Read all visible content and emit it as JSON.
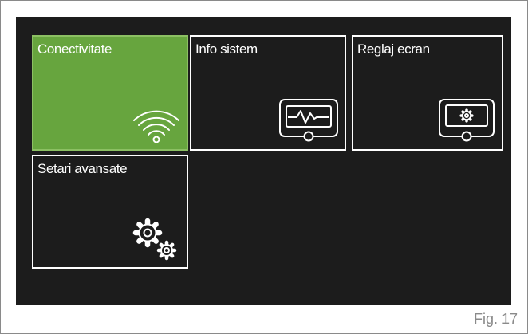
{
  "tiles": [
    {
      "id": "conectivitate",
      "label": "Conectivitate",
      "icon": "wifi-icon",
      "selected": true
    },
    {
      "id": "info-sistem",
      "label": "Info sistem",
      "icon": "monitor-waveform-icon",
      "selected": false
    },
    {
      "id": "reglaj-ecran",
      "label": "Reglaj ecran",
      "icon": "display-settings-icon",
      "selected": false
    },
    {
      "id": "setari-avansate",
      "label": "Setari avansate",
      "icon": "gears-icon",
      "selected": false
    }
  ],
  "caption": "Fig. 17",
  "colors": {
    "screen_bg": "#1c1c1c",
    "selected_tile": "#67a53e",
    "selected_border": "#8cc063",
    "tile_border": "#ffffff",
    "caption": "#8a8a8a"
  }
}
